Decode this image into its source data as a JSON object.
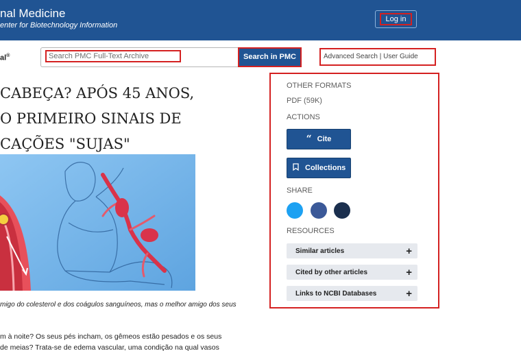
{
  "header": {
    "brand_title": "nal  Medicine",
    "brand_subtitle": "enter for Biotechnology Information",
    "login_label": "Log in"
  },
  "search": {
    "journal_mark": "al",
    "journal_mark_sup": "®",
    "placeholder": "Search PMC Full-Text Archive",
    "button_label": "Search in PMC",
    "advanced_search": "Advanced Search",
    "separator": "|",
    "user_guide": "User Guide"
  },
  "article": {
    "title_lines": [
      "CABEÇA? APÓS 45 ANOS,",
      "O PRIMEIRO SINAIS DE",
      "CAÇÕES \"SUJAS\""
    ],
    "caption": "migo do colesterol e dos coágulos sanguíneos, mas o melhor amigo dos seus",
    "body_lines": [
      "m à noite? Os seus pés incham, os gêmeos estão pesados e os seus",
      "de meias? Trata-se de edema vascular, uma condição na qual vasos"
    ]
  },
  "sidebar": {
    "other_formats_label": "OTHER FORMATS",
    "pdf_link": "PDF (59K)",
    "actions_label": "ACTIONS",
    "cite_label": "Cite",
    "collections_label": "Collections",
    "share_label": "SHARE",
    "share_colors": {
      "twitter": "#1da1f2",
      "facebook": "#3b5998",
      "email": "#1b2f4e"
    },
    "resources_label": "RESOURCES",
    "resources": [
      {
        "label": "Similar articles"
      },
      {
        "label": "Cited by other articles"
      },
      {
        "label": "Links to NCBI Databases"
      }
    ]
  }
}
